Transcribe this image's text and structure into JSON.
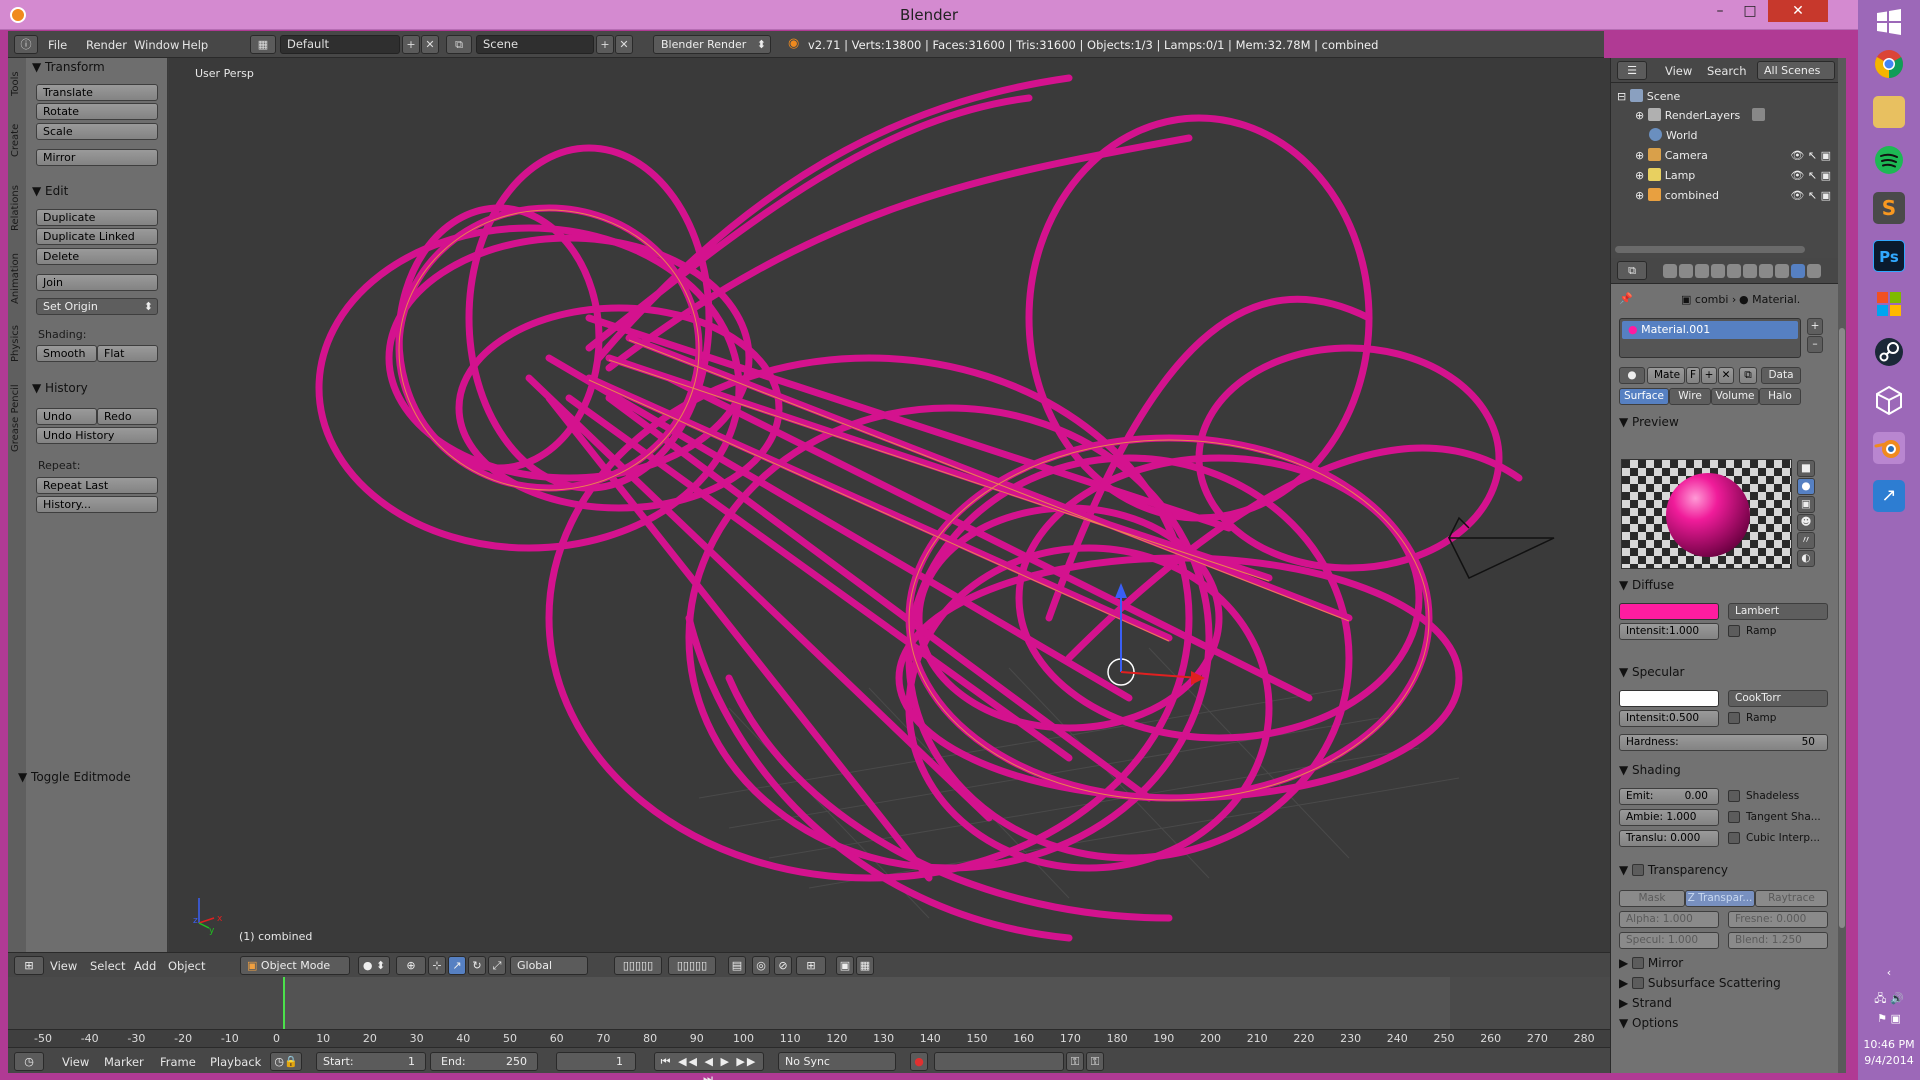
{
  "window": {
    "title": "Blender",
    "minimize": "–",
    "maximize": "□",
    "close": "✕"
  },
  "info": {
    "menus": [
      "File",
      "Render",
      "Window",
      "Help"
    ],
    "screen_layout": "Default",
    "scene": "Scene",
    "engine": "Blender Render",
    "stats": "v2.71 | Verts:13800 | Faces:31600 | Tris:31600 | Objects:1/3 | Lamps:0/1 | Mem:32.78M | combined"
  },
  "toolshelf": {
    "tabs": [
      "Tools",
      "Create",
      "Relations",
      "Animation",
      "Physics",
      "Grease Pencil"
    ],
    "transform_header": "Transform",
    "transform_buttons": [
      "Translate",
      "Rotate",
      "Scale",
      "Mirror"
    ],
    "edit_header": "Edit",
    "edit_buttons": [
      "Duplicate",
      "Duplicate Linked",
      "Delete",
      "Join"
    ],
    "set_origin": "Set Origin",
    "shading_label": "Shading:",
    "smooth": "Smooth",
    "flat": "Flat",
    "history_header": "History",
    "undo": "Undo",
    "redo": "Redo",
    "undo_history": "Undo History",
    "repeat_label": "Repeat:",
    "repeat_last": "Repeat Last",
    "history_dots": "History...",
    "toggle_editmode": "Toggle Editmode"
  },
  "viewport": {
    "view_label": "User Persp",
    "object_label": "(1) combined",
    "axis_x": "x",
    "axis_y": "y",
    "axis_z": "z"
  },
  "viewport_header": {
    "menus": [
      "View",
      "Select",
      "Add",
      "Object"
    ],
    "mode": "Object Mode",
    "orientation": "Global"
  },
  "timeline": {
    "ticks": [
      "-50",
      "-40",
      "-30",
      "-20",
      "-10",
      "0",
      "10",
      "20",
      "30",
      "40",
      "50",
      "60",
      "70",
      "80",
      "90",
      "100",
      "110",
      "120",
      "130",
      "140",
      "150",
      "160",
      "170",
      "180",
      "190",
      "200",
      "210",
      "220",
      "230",
      "240",
      "250",
      "260",
      "270",
      "280"
    ],
    "menus": [
      "View",
      "Marker",
      "Frame",
      "Playback"
    ],
    "start_label": "Start:",
    "start_value": "1",
    "end_label": "End:",
    "end_value": "250",
    "current_frame": "1",
    "sync": "No Sync"
  },
  "outliner": {
    "header_view": "View",
    "header_search": "Search",
    "header_scope": "All Scenes",
    "rows": [
      "Scene",
      "RenderLayers",
      "World",
      "Camera",
      "Lamp",
      "combined"
    ]
  },
  "properties": {
    "breadcrumb_object": "combi",
    "breadcrumb_material": "Material.",
    "material_name": "Material.001",
    "mate_field": "Mate",
    "f_label": "F",
    "data_btn": "Data",
    "tabs": [
      "Surface",
      "Wire",
      "Volume",
      "Halo"
    ],
    "preview_header": "Preview",
    "diffuse_header": "Diffuse",
    "diffuse_shader": "Lambert",
    "diffuse_intensity": "Intensit:1.000",
    "ramp": "Ramp",
    "specular_header": "Specular",
    "specular_shader": "CookTorr",
    "specular_intensity_label": "Intensit:",
    "specular_intensity_value": "0.500",
    "hardness_label": "Hardness:",
    "hardness_value": "50",
    "shading_header": "Shading",
    "emit_label": "Emit:",
    "emit_value": "0.00",
    "ambi": "Ambie: 1.000",
    "translu": "Translu: 0.000",
    "shadeless": "Shadeless",
    "tangent": "Tangent Sha...",
    "cubic": "Cubic Interp...",
    "transparency_header": "Transparency",
    "mask": "Mask",
    "ztransp": "Z Transpar...",
    "raytrace": "Raytrace",
    "alpha": "Alpha: 1.000",
    "fresnel": "Fresne: 0.000",
    "specul": "Specul: 1.000",
    "blend": "Blend: 1.250",
    "mirror_header": "Mirror",
    "sss_header": "Subsurface Scattering",
    "strand_header": "Strand",
    "options_header": "Options"
  },
  "taskbar": {
    "time": "10:46 PM",
    "date": "9/4/2014",
    "icons": [
      "windows-start-icon",
      "chrome-icon",
      "file-explorer-icon",
      "spotify-icon",
      "sublime-text-icon",
      "photoshop-icon",
      "windows-store-icon",
      "steam-icon",
      "unity-icon",
      "blender-icon",
      "remote-desktop-icon"
    ]
  },
  "colors": {
    "material": "#e0128c",
    "diffuse": "#ff1ca0",
    "specular": "#ffffff",
    "accent_blue": "#5680c2",
    "taskbar": "#9c68b8"
  }
}
